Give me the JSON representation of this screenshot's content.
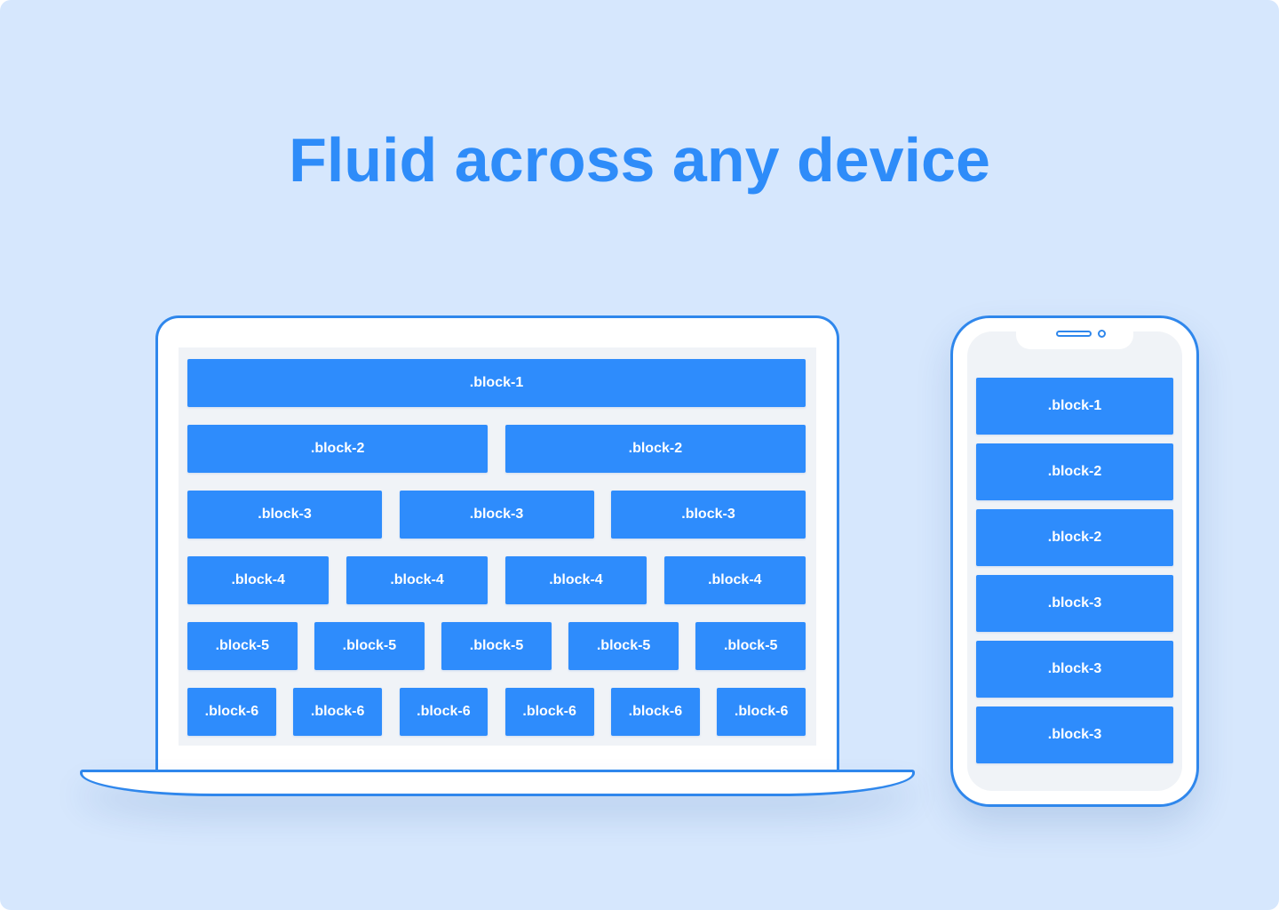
{
  "headline": "Fluid across any device",
  "colors": {
    "background": "#d6e7fd",
    "accent": "#2e8cfc",
    "outline": "#2f87ec",
    "screen": "#f0f3f7"
  },
  "laptop": {
    "rows": [
      [
        ".block-1"
      ],
      [
        ".block-2",
        ".block-2"
      ],
      [
        ".block-3",
        ".block-3",
        ".block-3"
      ],
      [
        ".block-4",
        ".block-4",
        ".block-4",
        ".block-4"
      ],
      [
        ".block-5",
        ".block-5",
        ".block-5",
        ".block-5",
        ".block-5"
      ],
      [
        ".block-6",
        ".block-6",
        ".block-6",
        ".block-6",
        ".block-6",
        ".block-6"
      ]
    ]
  },
  "phone": {
    "blocks": [
      ".block-1",
      ".block-2",
      ".block-2",
      ".block-3",
      ".block-3",
      ".block-3"
    ]
  }
}
